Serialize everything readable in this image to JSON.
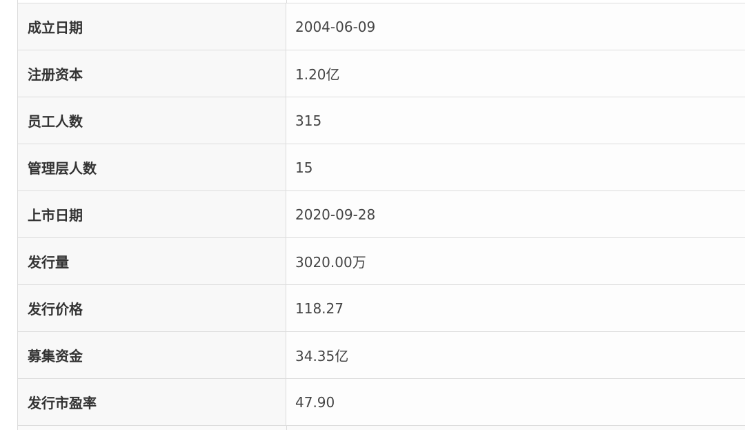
{
  "rows": [
    {
      "label": "成立日期",
      "value": "2004-06-09"
    },
    {
      "label": "注册资本",
      "value": "1.20亿"
    },
    {
      "label": "员工人数",
      "value": "315"
    },
    {
      "label": "管理层人数",
      "value": "15"
    },
    {
      "label": "上市日期",
      "value": "2020-09-28"
    },
    {
      "label": "发行量",
      "value": "3020.00万"
    },
    {
      "label": "发行价格",
      "value": "118.27"
    },
    {
      "label": "募集资金",
      "value": "34.35亿"
    },
    {
      "label": "发行市盈率",
      "value": "47.90"
    }
  ]
}
